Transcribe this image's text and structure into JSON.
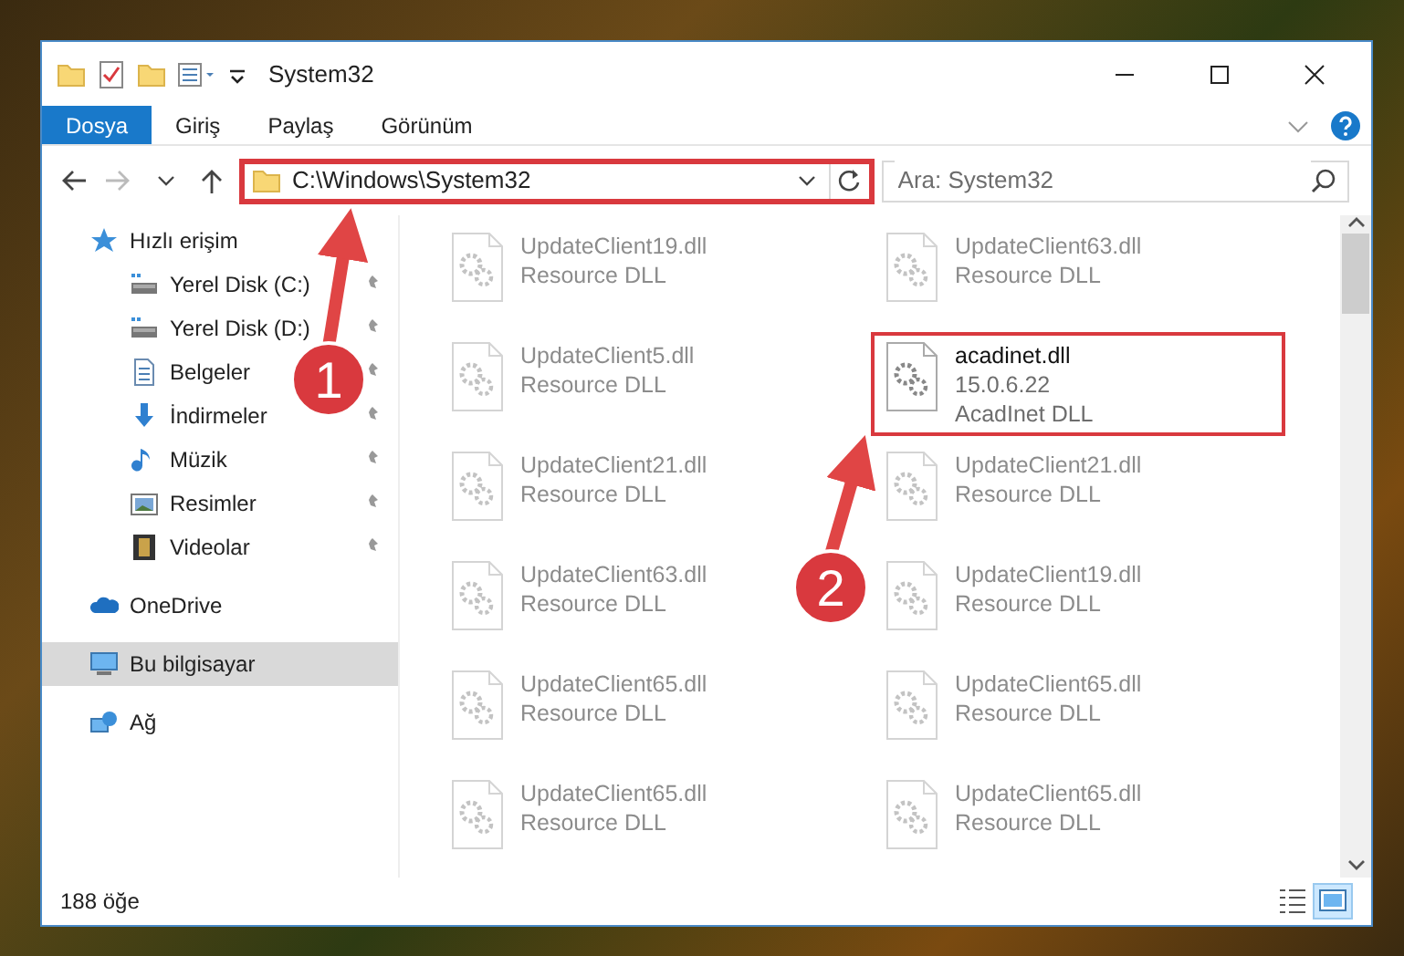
{
  "window": {
    "title": "System32"
  },
  "ribbon_tabs": [
    {
      "label": "Dosya",
      "kind": "file"
    },
    {
      "label": "Giriş",
      "kind": "tab"
    },
    {
      "label": "Paylaş",
      "kind": "tab"
    },
    {
      "label": "Görünüm",
      "kind": "tab"
    }
  ],
  "address_bar": {
    "path": "C:\\Windows\\System32",
    "highlighted": true
  },
  "search": {
    "placeholder": "Ara: System32"
  },
  "sidebar": {
    "items": [
      {
        "label": "Hızlı erişim",
        "kind": "star",
        "selected": false,
        "children": [
          {
            "label": "Yerel Disk (C:)",
            "kind": "drive",
            "pinned": true,
            "selected": false
          },
          {
            "label": "Yerel Disk (D:)",
            "kind": "drive",
            "pinned": true,
            "selected": false
          },
          {
            "label": "Belgeler",
            "kind": "doc",
            "pinned": true,
            "selected": false
          },
          {
            "label": "İndirmeler",
            "kind": "download",
            "pinned": true,
            "selected": false
          },
          {
            "label": "Müzik",
            "kind": "music",
            "pinned": true,
            "selected": false
          },
          {
            "label": "Resimler",
            "kind": "picture",
            "pinned": true,
            "selected": false
          },
          {
            "label": "Videolar",
            "kind": "film",
            "pinned": true,
            "selected": false
          }
        ]
      },
      {
        "label": "OneDrive",
        "kind": "cloud",
        "selected": false
      },
      {
        "label": "Bu bilgisayar",
        "kind": "computer",
        "selected": true
      },
      {
        "label": "Ağ",
        "kind": "network",
        "selected": false
      }
    ]
  },
  "files": [
    {
      "name": "UpdateClient19.dll",
      "details": [
        "Resource DLL"
      ],
      "faded": true,
      "highlighted": false
    },
    {
      "name": "UpdateClient63.dll",
      "details": [
        "Resource DLL"
      ],
      "faded": true,
      "highlighted": false
    },
    {
      "name": "UpdateClient5.dll",
      "details": [
        "Resource DLL"
      ],
      "faded": true,
      "highlighted": false
    },
    {
      "name": "acadinet.dll",
      "details": [
        "15.0.6.22",
        "AcadInet DLL"
      ],
      "faded": false,
      "highlighted": true
    },
    {
      "name": "UpdateClient21.dll",
      "details": [
        "Resource DLL"
      ],
      "faded": true,
      "highlighted": false
    },
    {
      "name": "UpdateClient21.dll",
      "details": [
        "Resource DLL"
      ],
      "faded": true,
      "highlighted": false
    },
    {
      "name": "UpdateClient63.dll",
      "details": [
        "Resource DLL"
      ],
      "faded": true,
      "highlighted": false
    },
    {
      "name": "UpdateClient19.dll",
      "details": [
        "Resource DLL"
      ],
      "faded": true,
      "highlighted": false
    },
    {
      "name": "UpdateClient65.dll",
      "details": [
        "Resource DLL"
      ],
      "faded": true,
      "highlighted": false
    },
    {
      "name": "UpdateClient65.dll",
      "details": [
        "Resource DLL"
      ],
      "faded": true,
      "highlighted": false
    },
    {
      "name": "UpdateClient65.dll",
      "details": [
        "Resource DLL"
      ],
      "faded": true,
      "highlighted": false
    },
    {
      "name": "UpdateClient65.dll",
      "details": [
        "Resource DLL"
      ],
      "faded": true,
      "highlighted": false
    }
  ],
  "status_bar": {
    "count": "188 öğe",
    "views": [
      {
        "kind": "details",
        "selected": false
      },
      {
        "kind": "large",
        "selected": true
      }
    ]
  },
  "callouts": [
    {
      "label": "1"
    },
    {
      "label": "2"
    }
  ]
}
